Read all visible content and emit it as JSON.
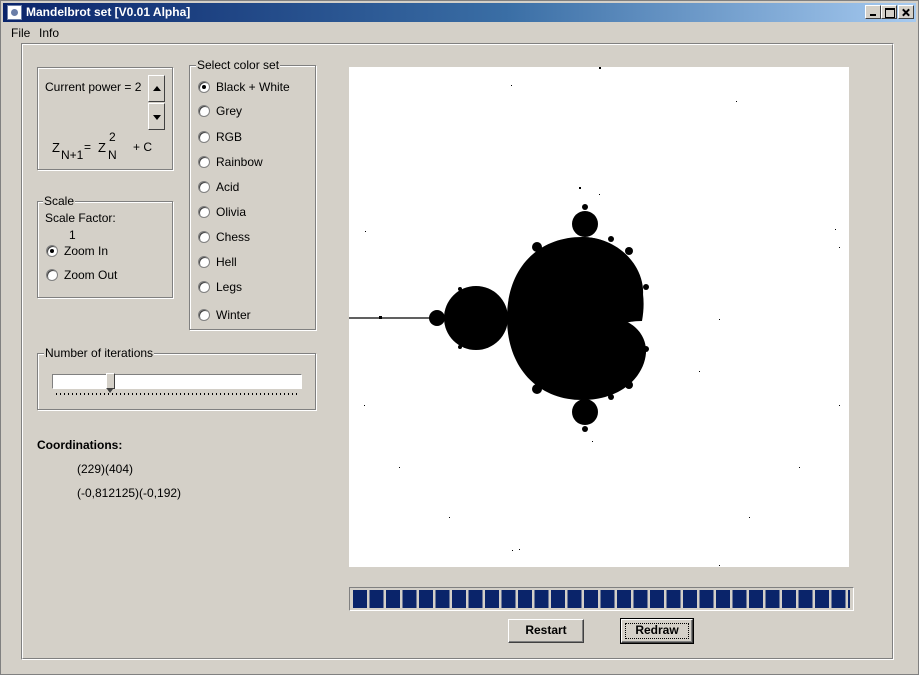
{
  "window": {
    "title": "Mandelbrot set [V0.01 Alpha]"
  },
  "menu": {
    "file": "File",
    "info": "Info"
  },
  "power": {
    "label": "Current power = 2",
    "formula": {
      "z": "Z",
      "sub_n1": "N+1",
      "eq": "=",
      "z2": "Z",
      "sup": "2",
      "sub_n": "N",
      "plus_c": "+ C"
    }
  },
  "scale": {
    "legend": "Scale",
    "factor_label": "Scale Factor:",
    "factor_value": "1",
    "options": [
      {
        "label": "Zoom In",
        "checked": true
      },
      {
        "label": "Zoom Out",
        "checked": false
      }
    ]
  },
  "color_set": {
    "legend": "Select  color set",
    "options": [
      {
        "label": "Black + White",
        "checked": true
      },
      {
        "label": "Grey",
        "checked": false
      },
      {
        "label": "RGB",
        "checked": false
      },
      {
        "label": "Rainbow",
        "checked": false
      },
      {
        "label": "Acid",
        "checked": false
      },
      {
        "label": "Olivia",
        "checked": false
      },
      {
        "label": "Chess",
        "checked": false
      },
      {
        "label": "Hell",
        "checked": false
      },
      {
        "label": "Legs",
        "checked": false
      },
      {
        "label": "Winter",
        "checked": false
      }
    ]
  },
  "iterations": {
    "legend": "Number of iterations",
    "slider_fraction": 0.22
  },
  "coordinates": {
    "title": "Coordinations:",
    "pixel": "(229)(404)",
    "complex": "(-0,812125)(-0,192)"
  },
  "progress": {
    "fraction": 1.0
  },
  "buttons": {
    "restart": "Restart",
    "redraw": "Redraw"
  }
}
